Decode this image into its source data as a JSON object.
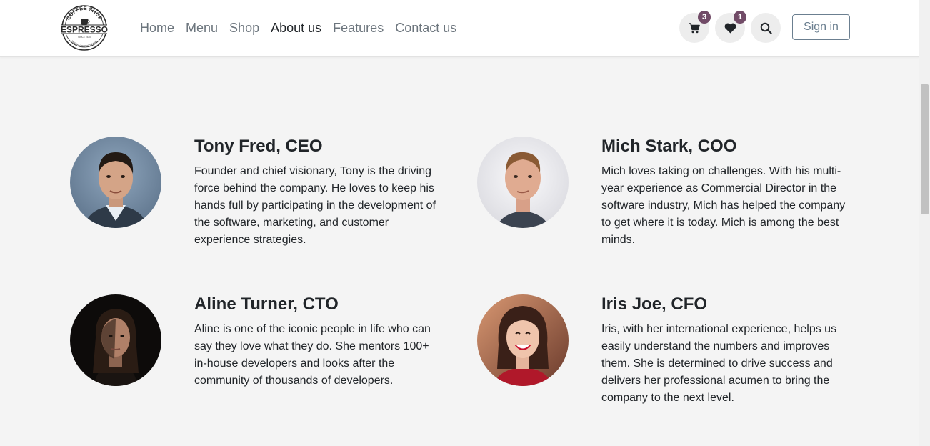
{
  "header": {
    "logo": {
      "top_text": "COFFEE SHOP",
      "main_text": "ESPRESSO",
      "bottom_text": "FRESH COFFEE BEANS",
      "since_text": "SINCE 1920"
    },
    "nav": [
      {
        "label": "Home",
        "active": false
      },
      {
        "label": "Menu",
        "active": false
      },
      {
        "label": "Shop",
        "active": false
      },
      {
        "label": "About us",
        "active": true
      },
      {
        "label": "Features",
        "active": false
      },
      {
        "label": "Contact us",
        "active": false
      }
    ],
    "cart_count": "3",
    "wishlist_count": "1",
    "signin_label": "Sign in",
    "accent_color": "#714b67"
  },
  "team": [
    {
      "name": "Tony Fred, CEO",
      "bio": "Founder and chief visionary, Tony is the driving force behind the company. He loves to keep his hands full by participating in the development of the software, marketing, and customer experience strategies.",
      "avatar_bg": "#6b8299"
    },
    {
      "name": "Mich Stark, COO",
      "bio": "Mich loves taking on challenges. With his multi-year experience as Commercial Director in the software industry, Mich has helped the company to get where it is today. Mich is among the best minds.",
      "avatar_bg": "#e8e8ec"
    },
    {
      "name": "Aline Turner, CTO",
      "bio": "Aline is one of the iconic people in life who can say they love what they do. She mentors 100+ in-house developers and looks after the community of thousands of developers.",
      "avatar_bg": "#0d0b0a"
    },
    {
      "name": "Iris Joe, CFO",
      "bio": "Iris, with her international experience, helps us easily understand the numbers and improves them. She is determined to drive success and delivers her professional acumen to bring the company to the next level.",
      "avatar_bg": "#b9644a"
    }
  ]
}
